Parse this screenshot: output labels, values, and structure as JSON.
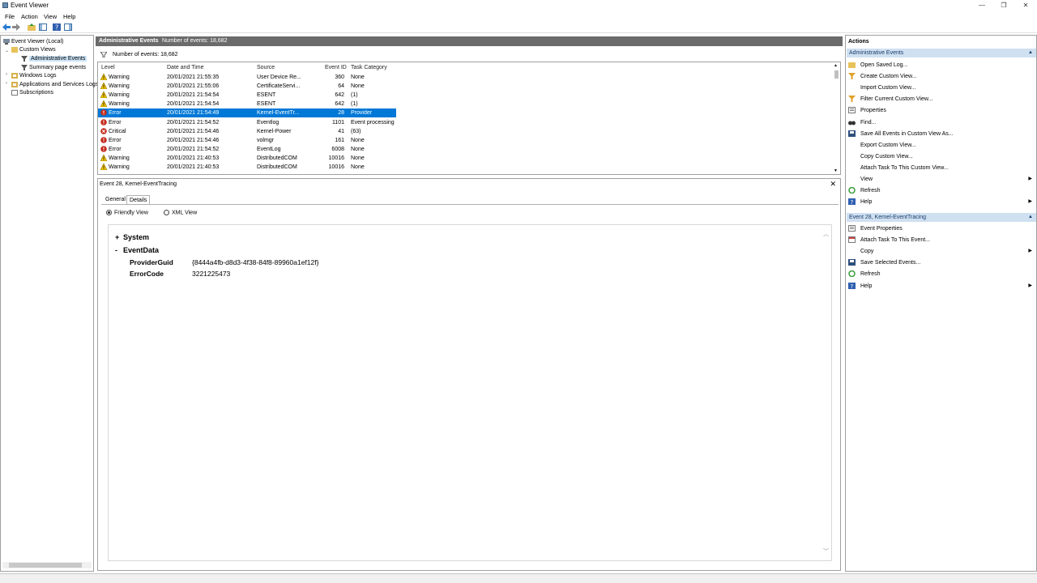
{
  "window": {
    "title": "Event Viewer",
    "minimize": "—",
    "restore": "❐",
    "close": "✕"
  },
  "menu": [
    "File",
    "Action",
    "View",
    "Help"
  ],
  "tree": {
    "root": "Event Viewer (Local)",
    "custom_views": "Custom Views",
    "admin_events": "Administrative Events",
    "summary": "Summary page events",
    "windows_logs": "Windows Logs",
    "app_logs": "Applications and Services Logs",
    "subscriptions": "Subscriptions"
  },
  "center": {
    "header_title": "Administrative Events",
    "header_count": "Number of events: 18,682",
    "filter_text": "Number of events: 18,682",
    "columns": {
      "level": "Level",
      "date": "Date and Time",
      "source": "Source",
      "event_id": "Event ID",
      "task": "Task Category"
    },
    "rows": [
      {
        "level": "Warning",
        "kind": "warning",
        "date": "20/01/2021 21:55:35",
        "source": "User Device Re...",
        "id": "360",
        "task": "None"
      },
      {
        "level": "Warning",
        "kind": "warning",
        "date": "20/01/2021 21:55:06",
        "source": "CertificateServi...",
        "id": "64",
        "task": "None"
      },
      {
        "level": "Warning",
        "kind": "warning",
        "date": "20/01/2021 21:54:54",
        "source": "ESENT",
        "id": "642",
        "task": "(1)"
      },
      {
        "level": "Warning",
        "kind": "warning",
        "date": "20/01/2021 21:54:54",
        "source": "ESENT",
        "id": "642",
        "task": "(1)"
      },
      {
        "level": "Error",
        "kind": "error",
        "date": "20/01/2021 21:54:49",
        "source": "Kernel-EventTr...",
        "id": "28",
        "task": "Provider",
        "selected": true
      },
      {
        "level": "Error",
        "kind": "error",
        "date": "20/01/2021 21:54:52",
        "source": "Eventlog",
        "id": "1101",
        "task": "Event processing"
      },
      {
        "level": "Critical",
        "kind": "critical",
        "date": "20/01/2021 21:54:46",
        "source": "Kernel-Power",
        "id": "41",
        "task": "(63)"
      },
      {
        "level": "Error",
        "kind": "error",
        "date": "20/01/2021 21:54:46",
        "source": "volmgr",
        "id": "161",
        "task": "None"
      },
      {
        "level": "Error",
        "kind": "error",
        "date": "20/01/2021 21:54:52",
        "source": "EventLog",
        "id": "6008",
        "task": "None"
      },
      {
        "level": "Warning",
        "kind": "warning",
        "date": "20/01/2021 21:40:53",
        "source": "DistributedCOM",
        "id": "10016",
        "task": "None"
      },
      {
        "level": "Warning",
        "kind": "warning",
        "date": "20/01/2021 21:40:53",
        "source": "DistributedCOM",
        "id": "10016",
        "task": "None"
      }
    ]
  },
  "detail": {
    "title": "Event 28, Kernel-EventTracing",
    "close": "✕",
    "tab_general": "General",
    "tab_details": "Details",
    "friendly_view": "Friendly View",
    "xml_view": "XML View",
    "system_expander": "+",
    "system_label": "System",
    "eventdata_expander": "-",
    "eventdata_label": "EventData",
    "provider_guid_key": "ProviderGuid",
    "provider_guid_value": "{8444a4fb-d8d3-4f38-84f8-89960a1ef12f}",
    "error_code_key": "ErrorCode",
    "error_code_value": "3221225473"
  },
  "actions": {
    "header": "Actions",
    "section1": "Administrative Events",
    "section1_items": [
      {
        "label": "Open Saved Log...",
        "icon": "folder-icon"
      },
      {
        "label": "Create Custom View...",
        "icon": "filter-icon"
      },
      {
        "label": "Import Custom View...",
        "icon": "none"
      },
      {
        "label": "Filter Current Custom View...",
        "icon": "filter-icon"
      },
      {
        "label": "Properties",
        "icon": "properties-icon"
      },
      {
        "label": "Find...",
        "icon": "binoculars-icon"
      },
      {
        "label": "Save All Events in Custom View As...",
        "icon": "save-icon"
      },
      {
        "label": "Export Custom View...",
        "icon": "none"
      },
      {
        "label": "Copy Custom View...",
        "icon": "none"
      },
      {
        "label": "Attach Task To This Custom View...",
        "icon": "none"
      },
      {
        "label": "View",
        "icon": "none",
        "submenu": true
      },
      {
        "label": "Refresh",
        "icon": "refresh-icon"
      },
      {
        "label": "Help",
        "icon": "help-icon",
        "submenu": true
      }
    ],
    "section2": "Event 28, Kernel-EventTracing",
    "section2_items": [
      {
        "label": "Event Properties",
        "icon": "properties-icon"
      },
      {
        "label": "Attach Task To This Event...",
        "icon": "task-icon"
      },
      {
        "label": "Copy",
        "icon": "copy-icon",
        "submenu": true
      },
      {
        "label": "Save Selected Events...",
        "icon": "save-icon"
      },
      {
        "label": "Refresh",
        "icon": "refresh-icon"
      },
      {
        "label": "Help",
        "icon": "help-icon",
        "submenu": true
      }
    ]
  }
}
